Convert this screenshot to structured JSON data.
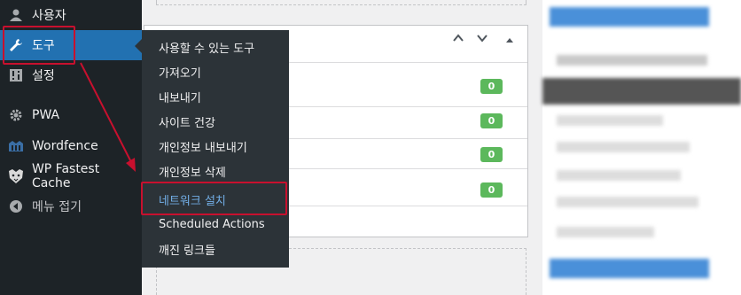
{
  "sidebar": {
    "items": [
      {
        "label": "사용자",
        "icon": "user-icon"
      },
      {
        "label": "도구",
        "icon": "wrench-icon"
      },
      {
        "label": "설정",
        "icon": "settings-icon"
      },
      {
        "label": "PWA",
        "icon": "gear-icon"
      },
      {
        "label": "Wordfence",
        "icon": "wordfence-icon"
      },
      {
        "label": "WP Fastest Cache",
        "icon": "cheetah-icon"
      },
      {
        "label": "메뉴 접기",
        "icon": "collapse-icon"
      }
    ]
  },
  "submenu": {
    "items": [
      {
        "label": "사용할 수 있는 도구"
      },
      {
        "label": "가져오기"
      },
      {
        "label": "내보내기"
      },
      {
        "label": "사이트 건강"
      },
      {
        "label": "개인정보 내보내기"
      },
      {
        "label": "개인정보 삭제"
      },
      {
        "label": "네트워크 설치"
      },
      {
        "label": "Scheduled Actions"
      },
      {
        "label": "깨진 링크들"
      }
    ]
  },
  "widget": {
    "counts": [
      "0",
      "0",
      "0",
      "0"
    ]
  },
  "colors": {
    "sidebar_bg": "#1d2327",
    "flyout_bg": "#2c3338",
    "active_blue": "#2271b1",
    "current_link": "#72aee6",
    "badge_green": "#5cb85c",
    "annotation_red": "#c8102e"
  }
}
